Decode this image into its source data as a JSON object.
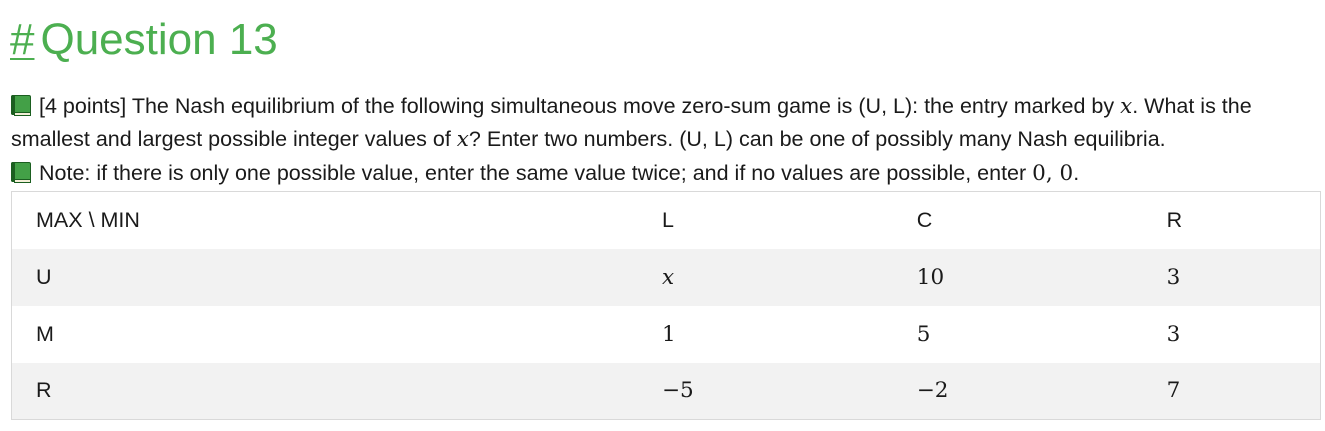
{
  "heading": {
    "anchor": "#",
    "title": "Question 13"
  },
  "question": {
    "icon": "green-book-icon",
    "text_before_var": "[4 points] The Nash equilibrium of the following simultaneous move zero-sum game is (U, L): the entry marked by ",
    "variable": "x",
    "text_after_var": ". What is the smallest and largest possible integer values of ",
    "variable_2": "x",
    "text_end": "? Enter two numbers. (U, L) can be one of possibly many Nash equilibria."
  },
  "note": {
    "icon": "green-book-icon",
    "text": "Note: if there is only one possible value, enter the same value twice; and if no values are possible, enter ",
    "math": "0, 0",
    "end": "."
  },
  "table": {
    "header": [
      "MAX \\ MIN",
      "L",
      "C",
      "R"
    ],
    "rows": [
      [
        "U",
        "x",
        "10",
        "3"
      ],
      [
        "M",
        "1",
        "5",
        "3"
      ],
      [
        "R",
        "−5",
        "−2",
        "7"
      ]
    ]
  },
  "colors": {
    "heading": "#4caf50",
    "icon": "#43a047",
    "row_stripe": "#f2f2f2"
  }
}
